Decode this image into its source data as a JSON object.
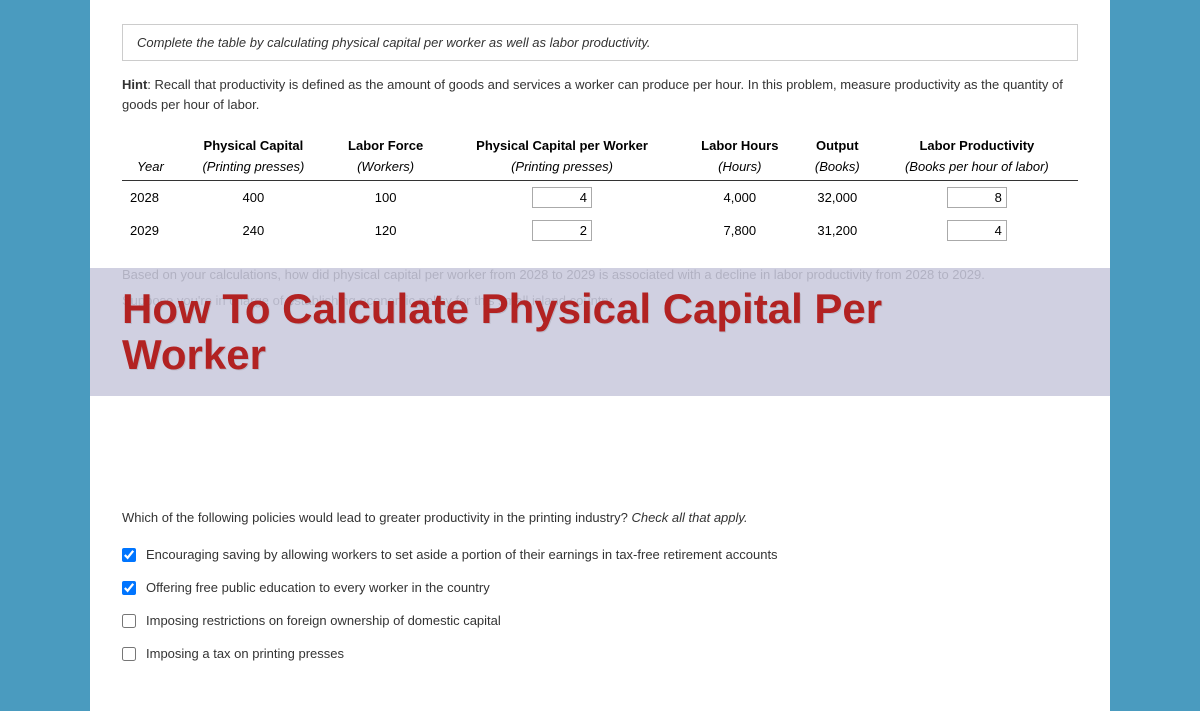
{
  "instructions": "Complete the table by calculating physical capital per worker as well as labor productivity.",
  "hint_label": "Hint",
  "hint_text": ": Recall that productivity is defined as the amount of goods and services a worker can produce per hour. In this problem, measure productivity as the quantity of goods per hour of labor.",
  "table": {
    "headers": [
      {
        "label": "Year",
        "subLabel": ""
      },
      {
        "label": "Physical Capital",
        "subLabel": "(Printing presses)"
      },
      {
        "label": "Labor Force",
        "subLabel": "(Workers)"
      },
      {
        "label": "Physical Capital per Worker",
        "subLabel": "(Printing presses)"
      },
      {
        "label": "Labor Hours",
        "subLabel": "(Hours)"
      },
      {
        "label": "Output",
        "subLabel": "(Books)"
      },
      {
        "label": "Labor Productivity",
        "subLabel": "(Books per hour of labor)"
      }
    ],
    "rows": [
      {
        "year": "2028",
        "physical_capital": "400",
        "labor_force": "100",
        "cap_per_worker": "4",
        "labor_hours": "4,000",
        "output": "32,000",
        "labor_productivity": "8"
      },
      {
        "year": "2029",
        "physical_capital": "240",
        "labor_force": "120",
        "cap_per_worker": "2",
        "labor_hours": "7,800",
        "output": "31,200",
        "labor_productivity": "4"
      }
    ]
  },
  "overlay": {
    "title_line1": "How To Calculate Physical Capital Per",
    "title_line2": "Worker"
  },
  "behind_text_1": "Based on your calculations, how did physical capital per worker from 2028 to 2029 is associated with a decline in labor productivity from 2028 to 2029.",
  "suppose_text": "Suppose you're in charge of establishing economic policy for this small island country.",
  "policy_question": "Which of the following policies would lead to greater productivity in the printing industry?",
  "policy_question_emphasis": "Check all that apply.",
  "policies": [
    {
      "text": "Encouraging saving by allowing workers to set aside a portion of their earnings in tax-free retirement accounts",
      "checked": true
    },
    {
      "text": "Offering free public education to every worker in the country",
      "checked": true
    },
    {
      "text": "Imposing restrictions on foreign ownership of domestic capital",
      "checked": false
    },
    {
      "text": "Imposing a tax on printing presses",
      "checked": false
    }
  ]
}
